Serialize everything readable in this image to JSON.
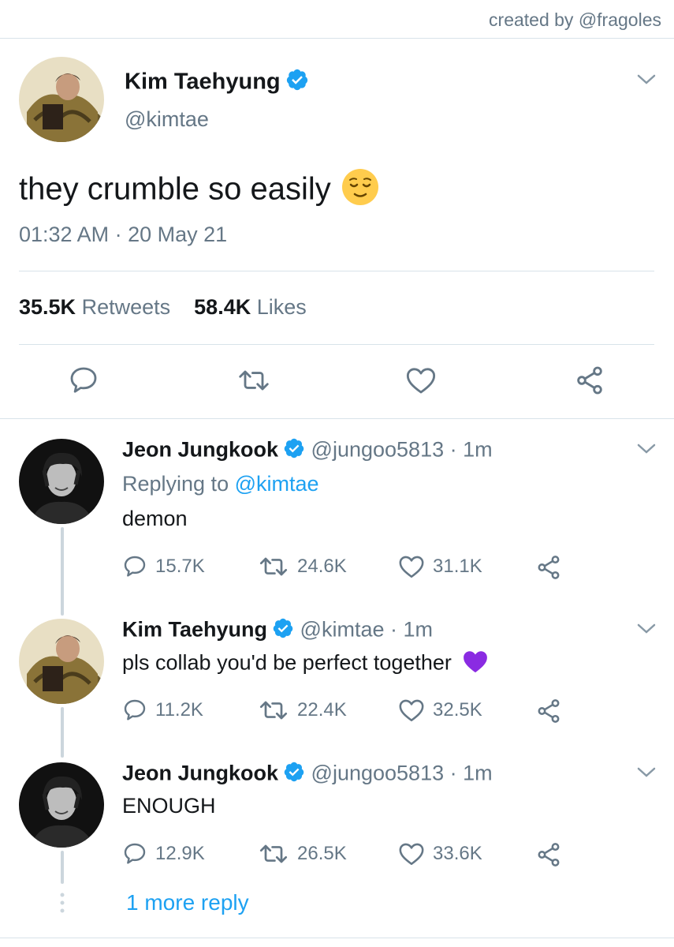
{
  "credit": "created by @fragoles",
  "main_tweet": {
    "name": "Kim Taehyung",
    "handle": "@kimtae",
    "text": "they crumble so easily",
    "emoji": "relieved-face",
    "timestamp": "01:32 AM · 20 May 21",
    "retweets_count": "35.5K",
    "retweets_label": "Retweets",
    "likes_count": "58.4K",
    "likes_label": "Likes"
  },
  "replies": [
    {
      "name": "Jeon Jungkook",
      "handle": "@jungoo5813",
      "time": "· 1m",
      "replying_prefix": "Replying to",
      "replying_to": "@kimtae",
      "text": "demon",
      "reply_count": "15.7K",
      "retweet_count": "24.6K",
      "like_count": "31.1K"
    },
    {
      "name": "Kim Taehyung",
      "handle": "@kimtae",
      "time": "· 1m",
      "text": "pls collab you'd be perfect together",
      "emoji": "purple-heart",
      "reply_count": "11.2K",
      "retweet_count": "22.4K",
      "like_count": "32.5K"
    },
    {
      "name": "Jeon Jungkook",
      "handle": "@jungoo5813",
      "time": "· 1m",
      "text": "ENOUGH",
      "reply_count": "12.9K",
      "retweet_count": "26.5K",
      "like_count": "33.6K"
    }
  ],
  "more_replies": "1 more reply",
  "colors": {
    "text": "#14171a",
    "secondary": "#657786",
    "link": "#1da1f2",
    "divider": "#d8e3ea",
    "verified": "#1da1f2"
  }
}
